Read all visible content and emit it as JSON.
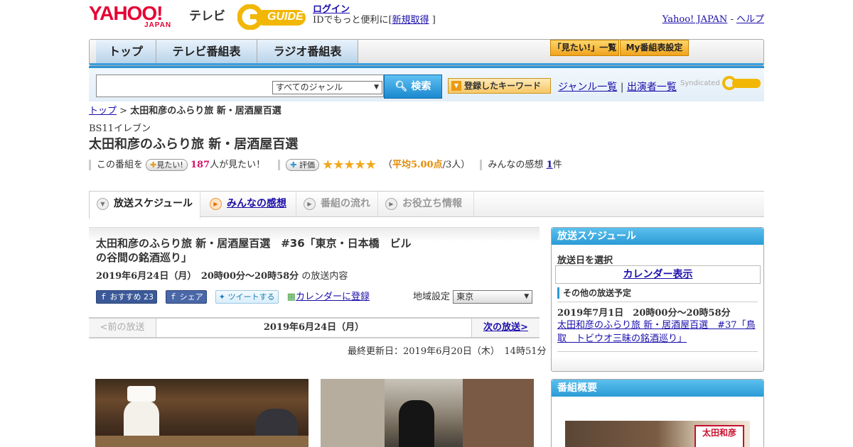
{
  "header": {
    "yahoo_logo": "YAHOO!",
    "yahoo_japan": "JAPAN",
    "tv_label": "テレビ",
    "gguide_logo": "GUIDE",
    "login": "ログイン",
    "login_desc": "IDでもっと便利に[",
    "register": "新規取得",
    "login_suffix": " ]",
    "yahoo_japan_link": "Yahoo! JAPAN",
    "separator": " - ",
    "help": "ヘルプ"
  },
  "nav": {
    "tabs": [
      "トップ",
      "テレビ番組表",
      "ラジオ番組表"
    ],
    "want_list": "「見たい!」一覧",
    "my_schedule": "My番組表設定"
  },
  "search": {
    "genre": "すべてのジャンル",
    "button": "検索",
    "keyword_button": "登録したキーワード",
    "genre_list": "ジャンル一覧",
    "divider": " | ",
    "performer_list": "出演者一覧",
    "syndicated": "Syndicated"
  },
  "breadcrumb": {
    "top": "トップ",
    "sep": " > ",
    "current": "太田和彦のふらり旅 新・居酒屋百選"
  },
  "program": {
    "channel": "BS11イレブン",
    "title": "太田和彦のふらり旅 新・居酒屋百選"
  },
  "stats": {
    "this_program": "この番組を",
    "want_button": "見たい!",
    "want_count": "187",
    "want_suffix": "人が見たい！",
    "rating_button": "評価",
    "stars": "★★★★★",
    "avg_prefix": "（",
    "avg": "平均5.00点",
    "avg_suffix": "/3人）",
    "impressions_label": "みんなの感想",
    "impressions_count": "1",
    "impressions_suffix": "件"
  },
  "content_tabs": [
    "放送スケジュール",
    "みんなの感想",
    "番組の流れ",
    "お役立ち情報"
  ],
  "episode": {
    "title": "太田和彦のふらり旅 新・居酒屋百選　#36「東京・日本橋　ビルの谷間の銘酒巡り」",
    "time": "2019年6月24日（月）　20時00分～20時58分",
    "time_suffix": "の放送内容",
    "fb_recommend": "おすすめ",
    "fb_count": "23",
    "fb_share": "シェア",
    "tweet": "ツイートする",
    "calendar_register": "カレンダーに登録",
    "region_label": "地域設定",
    "region": "東京",
    "prev": "<前の放送",
    "date": "2019年6月24日（月）",
    "next": "次の放送>",
    "updated": "最終更新日：2019年6月20日（木）　14時51分"
  },
  "sidebar": {
    "schedule_head": "放送スケジュール",
    "select_date": "放送日を選択",
    "calendar": "カレンダー表示",
    "other_label": "その他の放送予定",
    "other_time": "2019年7月1日　20時00分～20時58分",
    "other_title": "太田和彦のふらり旅 新・居酒屋百選　#37「鳥取　トビウオ三昧の銘酒巡り」",
    "overview_head": "番組概要",
    "overview_stamp": "太田和彦"
  },
  "colors": {
    "accent_blue": "#2b9bd6",
    "yahoo_red": "#e60033",
    "link": "#1a0dab",
    "want_pink": "#d6136a",
    "star": "#f1a71b"
  }
}
